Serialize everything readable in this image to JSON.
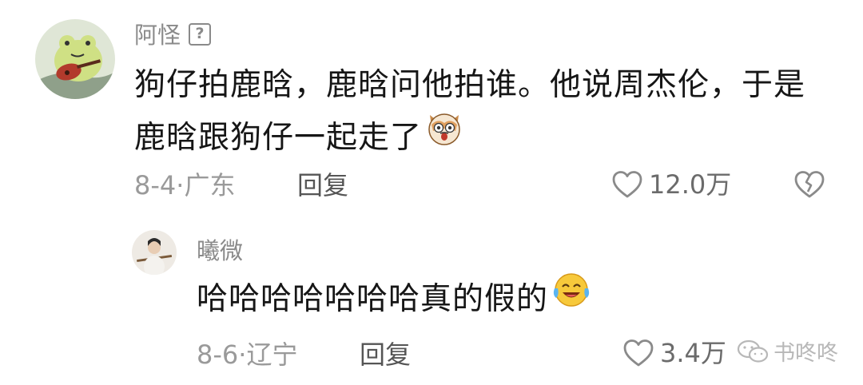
{
  "comments": [
    {
      "username": "阿怪",
      "badge_glyph": "?",
      "text": "狗仔拍鹿晗，鹿晗问他拍谁。他说周杰伦，于是鹿晗跟狗仔一起走了",
      "date": "8-4",
      "location": "广东",
      "reply_label": "回复",
      "likes": "12.0万",
      "emoji": "dog-face-emoji"
    },
    {
      "username": "曦微",
      "text": "哈哈哈哈哈哈哈真的假的",
      "date": "8-6",
      "location": "辽宁",
      "reply_label": "回复",
      "likes": "3.4万",
      "emoji": "laughing-tears-emoji"
    }
  ],
  "meta_separator": "·",
  "watermark": {
    "text": "书咚咚",
    "icon": "wechat-icon"
  },
  "colors": {
    "username": "#8a8a8a",
    "body_text": "#161616",
    "meta": "#9a9a9a",
    "reply": "#555555"
  }
}
